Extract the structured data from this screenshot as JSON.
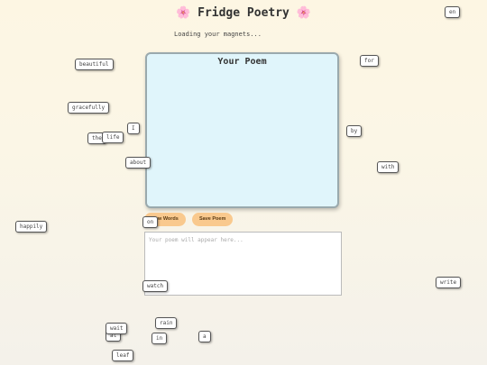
{
  "header": {
    "title": "Fridge Poetry",
    "flower_icon": "🌸",
    "loading_text": "Loading your magnets..."
  },
  "board": {
    "title": "Your Poem"
  },
  "buttons": {
    "new_words": "New Words",
    "save_poem": "Save Poem"
  },
  "output": {
    "placeholder": "Your poem will appear here..."
  },
  "magnets": {
    "en": "en",
    "for": "for",
    "beautiful": "beautiful",
    "gracefully": "gracefully",
    "i": "I",
    "the": "the",
    "life": "life",
    "by": "by",
    "about": "about",
    "with": "with",
    "happily": "happily",
    "on": "on",
    "write": "write",
    "watch": "watch",
    "rain": "rain",
    "wait": "wait",
    "at": "at",
    "in": "in",
    "a": "a",
    "leaf": "leaf"
  }
}
